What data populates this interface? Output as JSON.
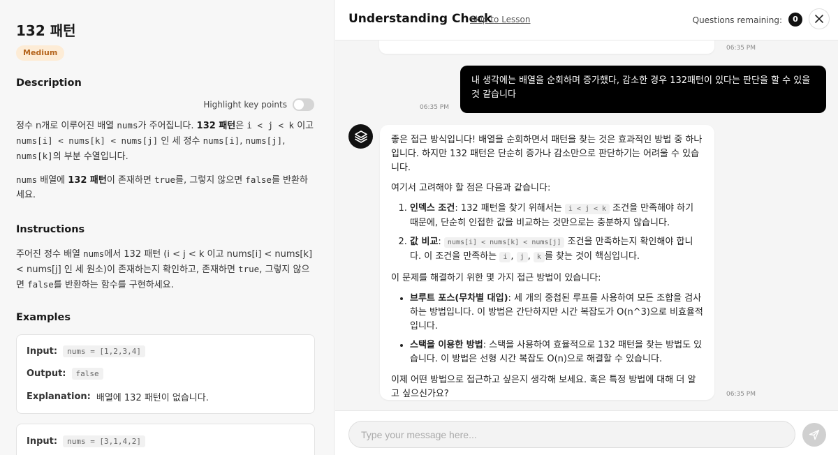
{
  "problem": {
    "title": "132 패턴",
    "difficulty": "Medium",
    "description_heading": "Description",
    "highlight_label": "Highlight key points",
    "desc_p1": {
      "a": "정수 n개로 이루어진 배열 ",
      "b": "nums",
      "c": "가 주어집니다. ",
      "d": "132 패턴",
      "e": "은 ",
      "f": "i < j < k",
      "g": " 이고 ",
      "h": "nums[i] < nums[k] < nums[j]",
      "i": " 인 세 정수 ",
      "j": "nums[i]",
      "k": ", ",
      "l": "nums[j]",
      "m": ", ",
      "n": "nums[k]",
      "o": "의 부분 수열입니다."
    },
    "desc_p2": {
      "a": "nums",
      "b": " 배열에 ",
      "c": "132 패턴",
      "d": "이 존재하면 ",
      "e": "true",
      "f": "를, 그렇지 않으면 ",
      "g": "false",
      "h": "를 반환하세요."
    },
    "instructions_heading": "Instructions",
    "instr": {
      "a": "주어진 정수 배열 ",
      "b": "nums",
      "c": "에서 132 패턴 (i < j < k 이고 nums[i] < nums[k] < nums[j] 인 세 원소)이 존재하는지 확인하고, 존재하면 ",
      "d": "true",
      "e": ", 그렇지 않으면 ",
      "f": "false",
      "g": "를 반환하는 함수를 구현하세요."
    },
    "examples_heading": "Examples",
    "examples": [
      {
        "input_label": "Input:",
        "input": "nums = [1,2,3,4]",
        "output_label": "Output:",
        "output": "false",
        "explanation_label": "Explanation:",
        "explanation": "배열에 132 패턴이 없습니다."
      },
      {
        "input_label": "Input:",
        "input": "nums = [3,1,4,2]"
      }
    ]
  },
  "chat": {
    "header_title": "Understanding Check",
    "skip_label": "Skip to Lesson",
    "remaining_label": "Questions remaining:",
    "remaining_count": "0",
    "timestamps": [
      "06:35 PM",
      "06:35 PM",
      "06:35 PM"
    ],
    "user_message": "내 생각에는 배열을 순회하며 증가했다, 감소한 경우 132패턴이 있다는 판단을 할 수 있을 것 같습니다",
    "bot": {
      "p1": "좋은 접근 방식입니다! 배열을 순회하면서 패턴을 찾는 것은 효과적인 방법 중 하나입니다. 하지만 132 패턴은 단순히 증가나 감소만으로 판단하기는 어려울 수 있습니다.",
      "p2": "여기서 고려해야 할 점은 다음과 같습니다:",
      "ol1": {
        "bold": "인덱스 조건",
        "a": ": 132 패턴을 찾기 위해서는 ",
        "code": "i < j < k",
        "b": " 조건을 만족해야 하기 때문에, 단순히 인접한 값을 비교하는 것만으로는 충분하지 않습니다."
      },
      "ol2": {
        "bold": "값 비교",
        "a": ": ",
        "code": "nums[i] < nums[k] < nums[j]",
        "b": " 조건을 만족하는지 확인해야 합니다. 이 조건을 만족하는 ",
        "c1": "i",
        "sep1": ", ",
        "c2": "j",
        "sep2": ", ",
        "c3": "k",
        "c": "를 찾는 것이 핵심입니다."
      },
      "p3": "이 문제를 해결하기 위한 몇 가지 접근 방법이 있습니다:",
      "ul1": {
        "bold": "브루트 포스(무차별 대입)",
        "a": ": 세 개의 중첩된 루프를 사용하여 모든 조합을 검사하는 방법입니다. 이 방법은 간단하지만 시간 복잡도가 O(n^3)으로 비효율적입니다."
      },
      "ul2": {
        "bold": "스택을 이용한 방법",
        "a": ": 스택을 사용하여 효율적으로 132 패턴을 찾는 방법도 있습니다. 이 방법은 선형 시간 복잡도 O(n)으로 해결할 수 있습니다."
      },
      "p4": "이제 어떤 방법으로 접근하고 싶은지 생각해 보세요. 혹은 특정 방법에 대해 더 알고 싶으신가요?"
    },
    "input_placeholder": "Type your message here..."
  }
}
